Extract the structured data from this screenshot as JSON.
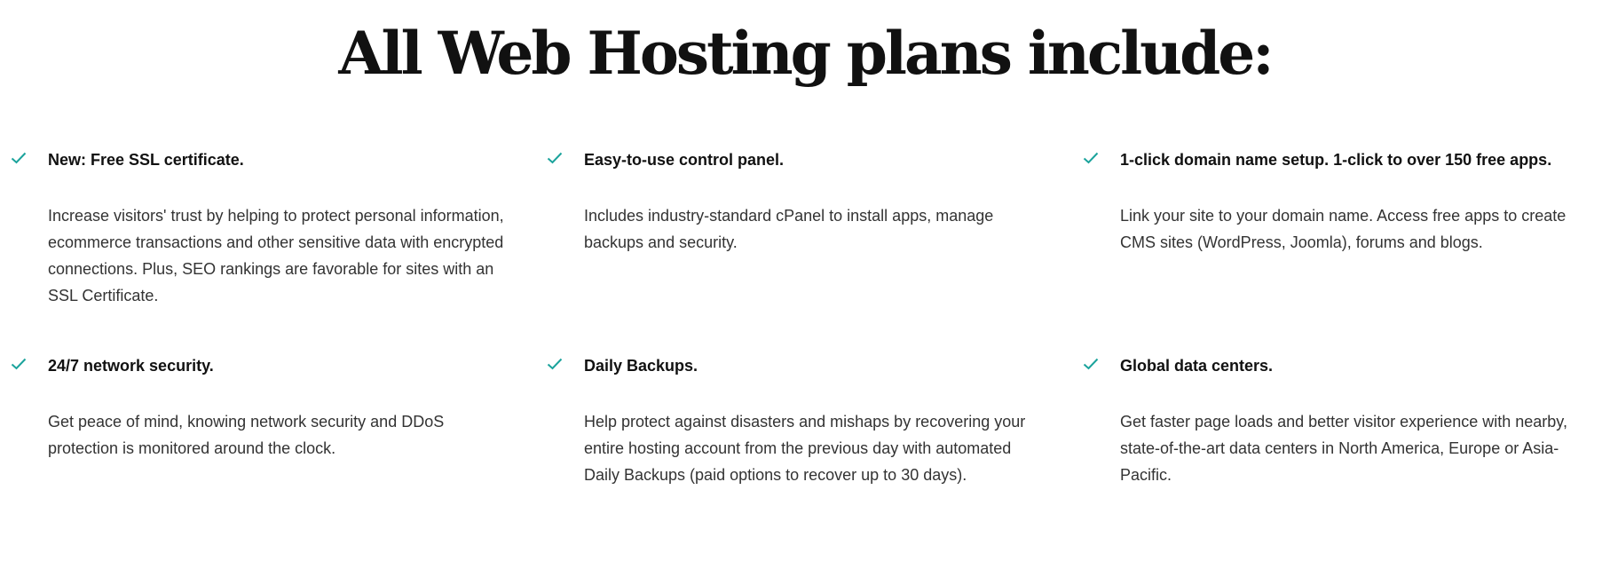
{
  "page": {
    "title": "All Web Hosting plans include:"
  },
  "colors": {
    "check_accent": "#1ba39c",
    "title_text": "#111111",
    "body_text": "#333333"
  },
  "features": [
    {
      "icon": "check-icon",
      "title": "New: Free SSL certificate.",
      "description": "Increase visitors' trust by helping to protect personal information, ecommerce transactions and other sensitive data with encrypted connections. Plus, SEO rankings are favorable for sites with an SSL Certificate."
    },
    {
      "icon": "check-icon",
      "title": "Easy-to-use control panel.",
      "description": "Includes industry-standard cPanel to install apps, manage backups and security."
    },
    {
      "icon": "check-icon",
      "title": "1-click domain name setup. 1-click to over 150 free apps.",
      "description": "Link your site to your domain name. Access free apps to create CMS sites (WordPress, Joomla), forums and blogs."
    },
    {
      "icon": "check-icon",
      "title": "24/7 network security.",
      "description": "Get peace of mind, knowing network security and DDoS protection is monitored around the clock."
    },
    {
      "icon": "check-icon",
      "title": "Daily Backups.",
      "description": "Help protect against disasters and mishaps by recovering your entire hosting account from the previous day with automated Daily Backups (paid options to recover up to 30 days)."
    },
    {
      "icon": "check-icon",
      "title": "Global data centers.",
      "description": "Get faster page loads and better visitor experience with nearby, state-of-the-art data centers in North America, Europe or Asia-Pacific."
    }
  ]
}
